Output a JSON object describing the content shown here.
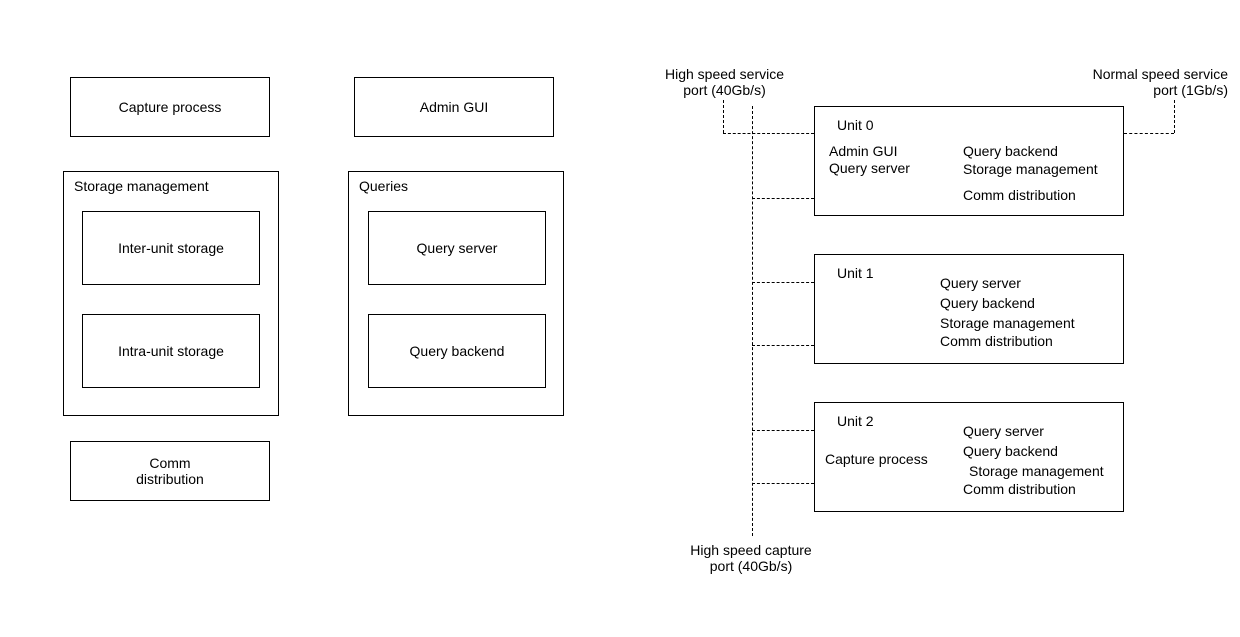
{
  "left": {
    "capture_process": "Capture process",
    "admin_gui": "Admin GUI",
    "storage_management": {
      "title": "Storage management",
      "inter": "Inter-unit storage",
      "intra": "Intra-unit storage"
    },
    "queries": {
      "title": "Queries",
      "server": "Query server",
      "backend": "Query backend"
    },
    "comm_distribution": "Comm\ndistribution"
  },
  "right": {
    "high_speed_service": "High speed service\nport (40Gb/s)",
    "normal_speed_service": "Normal speed service\nport (1Gb/s)",
    "high_speed_capture": "High speed capture\nport (40Gb/s)",
    "unit0": {
      "title": "Unit 0",
      "left_col": [
        "Admin GUI",
        "Query server"
      ],
      "right_col": [
        "Query backend",
        "Storage management",
        "Comm distribution"
      ]
    },
    "unit1": {
      "title": "Unit 1",
      "lines": [
        "Query server",
        "Query backend",
        "Storage management",
        "Comm distribution"
      ]
    },
    "unit2": {
      "title": "Unit 2",
      "left": "Capture process",
      "lines": [
        "Query server",
        "Query backend",
        "Storage management",
        "Comm distribution"
      ]
    }
  }
}
